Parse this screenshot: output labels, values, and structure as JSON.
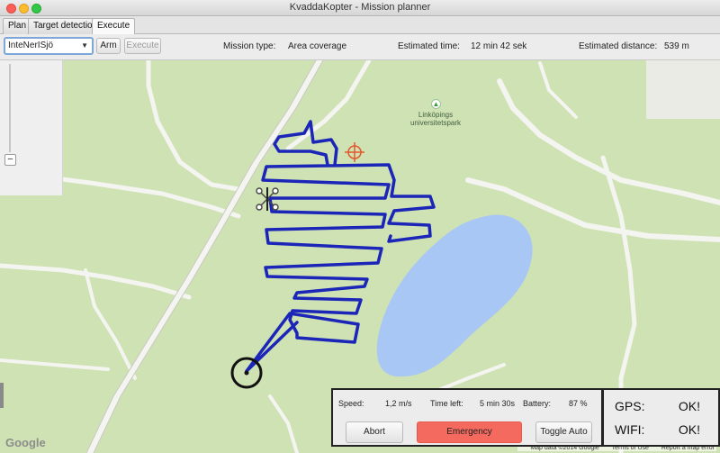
{
  "window": {
    "title": "KvaddaKopter -  Mission planner"
  },
  "tabs": [
    {
      "label": "Plan"
    },
    {
      "label": "Target detection"
    },
    {
      "label": "Execute"
    }
  ],
  "toolbar": {
    "network_select": "InteNerISjö",
    "arm_label": "Arm",
    "execute_label": "Execute",
    "mission_type_label": "Mission type:",
    "mission_type_value": "Area coverage",
    "est_time_label": "Estimated time:",
    "est_time_value": "12 min 42 sek",
    "est_distance_label": "Estimated distance:",
    "est_distance_value": "539 m"
  },
  "map": {
    "zoom_out": "−",
    "park_label_line1": "Linköpings",
    "park_label_line2": "universitetspark",
    "google_logo": "Google",
    "credit_data": "Map data ©2014 Google",
    "credit_terms": "Terms of Use",
    "credit_report": "Report a map error",
    "colors": {
      "grass": "#cfe2b3",
      "road": "#f4f4f1",
      "water": "#a8c7f5",
      "route": "#1b26b8",
      "target": "#e2572c"
    }
  },
  "status": {
    "speed_label": "Speed:",
    "speed_value": "1,2 m/s",
    "time_left_label": "Time left:",
    "time_left_value": "5 min 30s",
    "battery_label": "Battery:",
    "battery_value": "87 %",
    "abort_label": "Abort",
    "emergency_label": "Emergency",
    "toggle_auto_label": "Toggle Auto"
  },
  "connection": {
    "gps_label": "GPS:",
    "gps_value": "OK!",
    "wifi_label": "WIFI:",
    "wifi_value": "OK!"
  }
}
